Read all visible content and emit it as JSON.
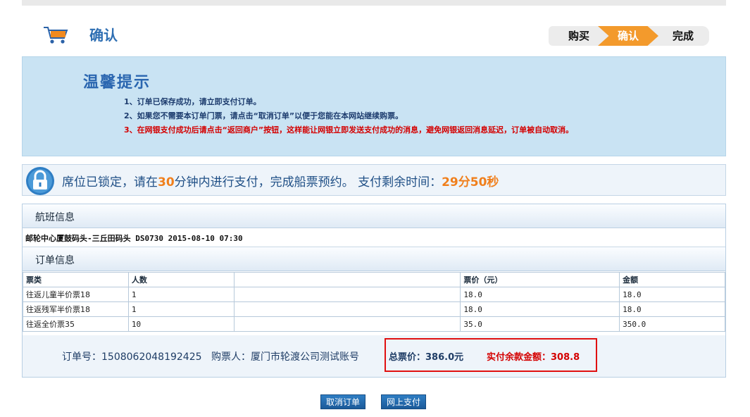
{
  "header": {
    "title": "确认",
    "steps": [
      "购买",
      "确认",
      "完成"
    ],
    "active_step_color": "#f39a2c"
  },
  "tips": {
    "title": "温馨提示",
    "items": [
      "1、订单已保存成功，请立即支付订单。",
      "2、如果您不需要本订单门票，请点击“取消订单”以便于您能在本网站继续购票。",
      "3、在网银支付成功后请点击“返回商户”按钮，这样能让网银立即发送支付成功的消息，避免网银返回消息延迟，订单被自动取消。"
    ]
  },
  "lock": {
    "prefix": "席位已锁定，请在",
    "minutes": "30",
    "middle": "分钟内进行支付，完成船票预约。  支付剩余时间：",
    "remaining": "29分50秒"
  },
  "flight": {
    "section_title": "航班信息",
    "voyage": "邮轮中心厦鼓码头-三丘田码头 DS0730 2015-08-10 07:30"
  },
  "order": {
    "section_title": "订单信息",
    "columns": [
      "票类",
      "人数",
      "",
      "票价（元）",
      "金额"
    ],
    "rows": [
      [
        "往返儿童半价票18",
        "1",
        "",
        "18.0",
        "18.0"
      ],
      [
        "往返残军半价票18",
        "1",
        "",
        "18.0",
        "18.0"
      ],
      [
        "往返全价票35",
        "10",
        "",
        "35.0",
        "350.0"
      ]
    ]
  },
  "summary": {
    "order_no": "订单号：1508062048192425",
    "buyer": "购票人：厦门市轮渡公司测试账号",
    "total": "总票价：386.0元",
    "due": "实付余款金额：308.8"
  },
  "buttons": {
    "cancel": "取消订单",
    "pay": "网上支付"
  }
}
